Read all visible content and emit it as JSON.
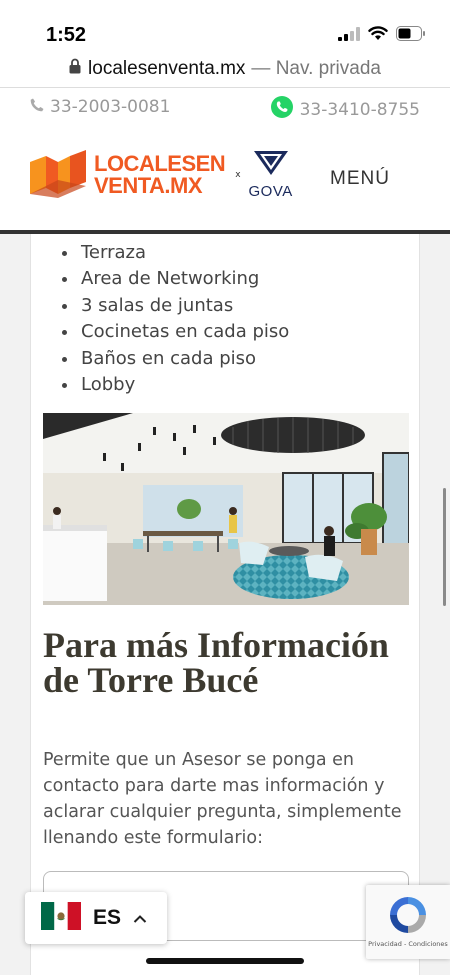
{
  "status_bar": {
    "time": "1:52"
  },
  "browser": {
    "domain": "localesenventa.mx",
    "private_label": "— Nav. privada"
  },
  "header": {
    "phone": "33-2003-0081",
    "whatsapp": "33-3410-8755",
    "logo_line1": "LOCALESEN",
    "logo_line2": "VENTA.MX",
    "logo_separator": "x",
    "partner_name": "GOVA",
    "menu_label": "MENÚ"
  },
  "amenities": [
    "Terraza",
    "Area de Networking",
    "3 salas de juntas",
    "Cocinetas en cada piso",
    "Baños en cada piso",
    "Lobby"
  ],
  "info": {
    "title": "Para más Información de Torre Bucé",
    "text": "Permite que un Asesor se ponga en contacto para darte mas información y aclarar cualquier pregunta, simplemente llenando este formulario:"
  },
  "language": {
    "code": "ES"
  },
  "recaptcha": {
    "links": "Privacidad - Condiciones"
  },
  "colors": {
    "brand_orange": "#f05a22",
    "gova_navy": "#1b2a5c",
    "whatsapp_green": "#25d366"
  }
}
